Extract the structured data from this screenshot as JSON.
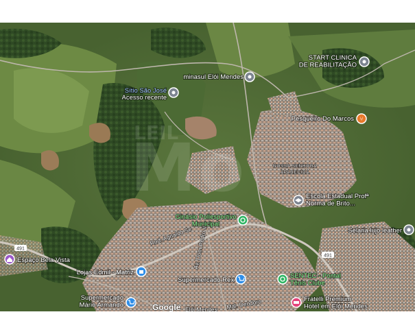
{
  "watermark": "LEILÕES M",
  "google_logo": "Google",
  "colors": {
    "pin_gray": "#7d8591",
    "pin_blue": "#2f8ee8",
    "pin_orange": "#e8792a",
    "pin_green": "#2fb563",
    "pin_pink": "#e4447c",
    "pin_purple": "#9a59c7",
    "label_green": "#7CF08A"
  },
  "places": [
    {
      "name": "START CLINICA\nDE REABILITAÇÃO",
      "icon": "building-icon"
    },
    {
      "name": "minasul Elói Mendes",
      "icon": "building-icon"
    },
    {
      "name": "Sítio São José",
      "sub": "Acesso recente",
      "icon": "building-icon"
    },
    {
      "name": "Pesqueiro Do Marcos",
      "icon": "restaurant-icon"
    },
    {
      "name": "Escola Estadual Profª\nNorma de Brito...",
      "icon": "school-icon"
    },
    {
      "name": "Ginásio Poliesportivo\nMunicipal",
      "icon": "stadium-icon"
    },
    {
      "name": "Selaria lujo leather",
      "icon": "building-icon"
    },
    {
      "name": "Espaço Bela Vista",
      "icon": "house-icon"
    },
    {
      "name": "Lojas Edmil - Matriz",
      "icon": "shopping-icon"
    },
    {
      "name": "Supermercado Rex",
      "icon": "cart-icon"
    },
    {
      "name": "SENTEC - Pontal\nTênis Clube",
      "icon": "stadium-icon"
    },
    {
      "name": "Supermercado\nMário Armando",
      "icon": "cart-icon"
    },
    {
      "name": "Fratelli Premium\nHotel em Elói Mendes",
      "icon": "hotel-icon"
    }
  ],
  "areas": [
    "NOSSA SENHORA",
    "APARECIDA"
  ],
  "roads": [
    "Rod. Agnaldo Se",
    "Av. Dom Pedro II",
    "Mal. Deodoro",
    "Elói Mendes"
  ],
  "road_shields": [
    "491",
    "491"
  ]
}
